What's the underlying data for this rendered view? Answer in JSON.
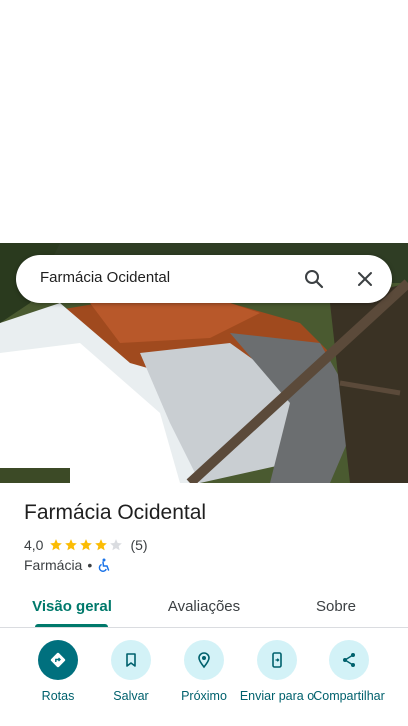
{
  "search": {
    "query": "Farmácia Ocidental"
  },
  "place": {
    "name": "Farmácia Ocidental",
    "rating_text": "4,0",
    "rating": 4.0,
    "rating_max": 5,
    "review_count": "(5)",
    "category": "Farmácia",
    "separator": "•"
  },
  "tabs": [
    {
      "label": "Visão geral",
      "selected": true
    },
    {
      "label": "Avaliações",
      "selected": false
    },
    {
      "label": "Sobre",
      "selected": false
    }
  ],
  "actions": [
    {
      "label": "Rotas",
      "icon": "directions-icon"
    },
    {
      "label": "Salvar",
      "icon": "bookmark-icon"
    },
    {
      "label": "Próximo",
      "icon": "nearby-icon"
    },
    {
      "label": "Enviar para o",
      "icon": "send-to-phone-icon"
    },
    {
      "label": "Compartilhar",
      "icon": "share-icon"
    }
  ],
  "colors": {
    "accent": "#00796b",
    "action_bg": "#d3f2f7",
    "action_primary_bg": "#00707e",
    "star_fill": "#fbbc04",
    "star_empty": "#dadce0"
  }
}
